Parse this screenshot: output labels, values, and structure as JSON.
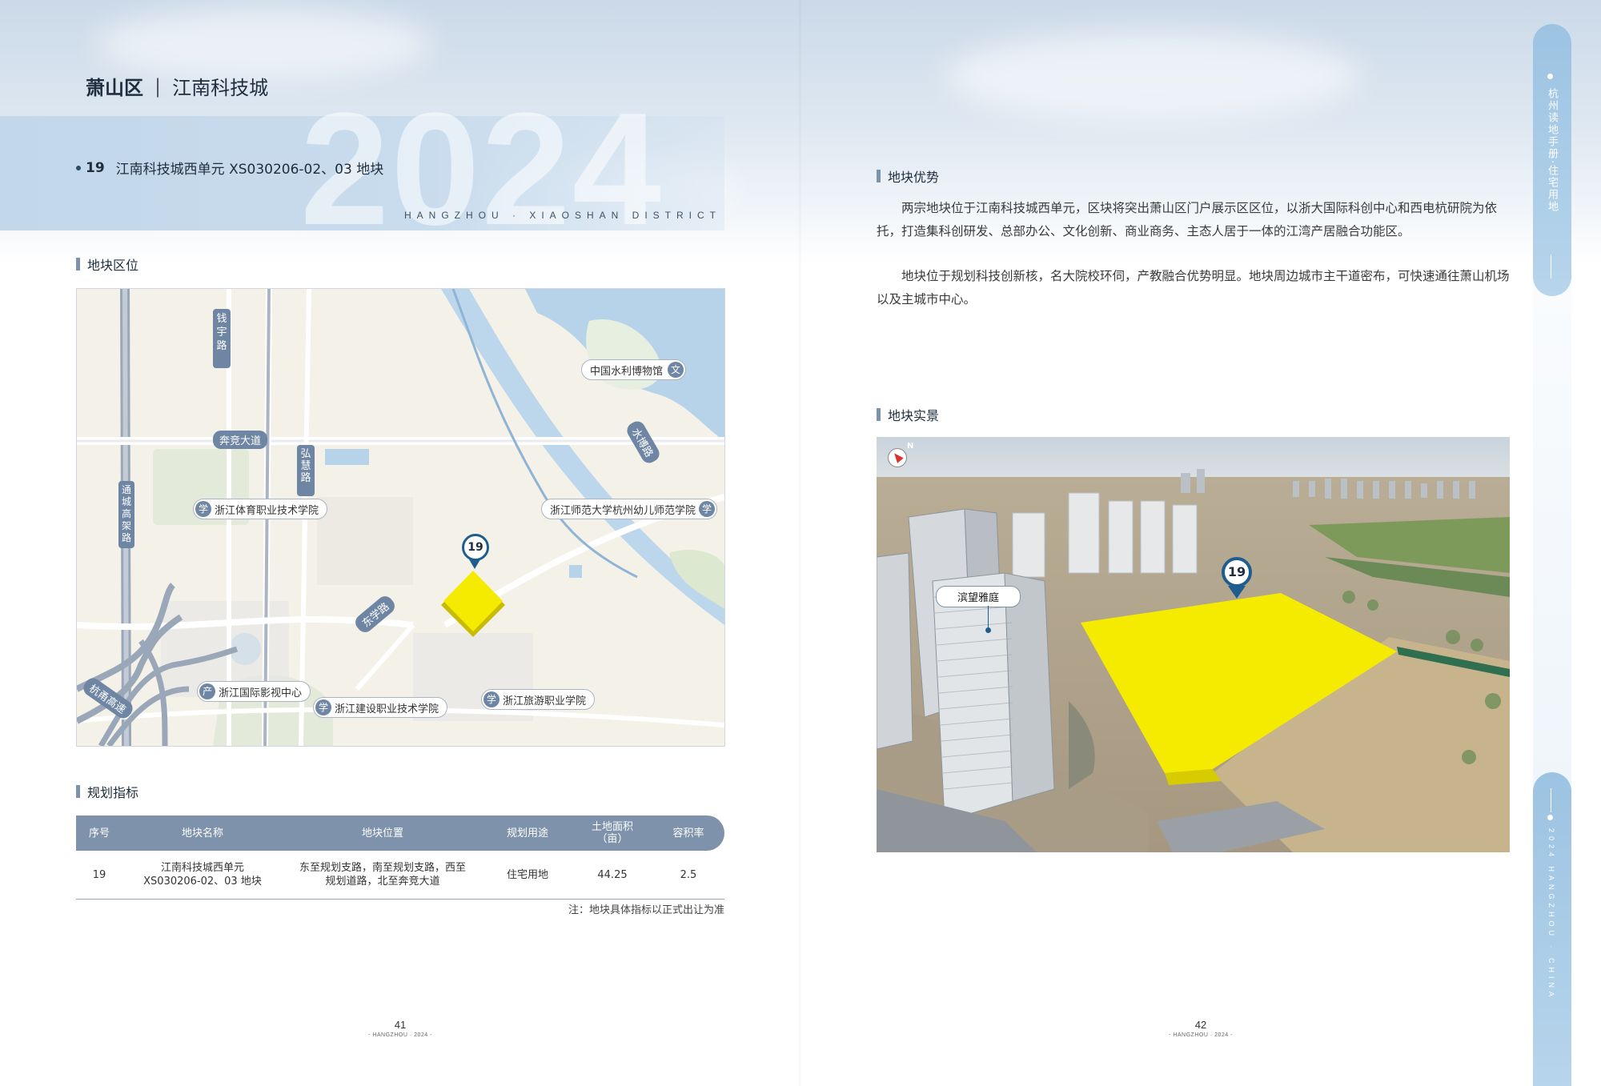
{
  "header": {
    "district_bold": "萧山区",
    "separator": "|",
    "district_light": "江南科技城",
    "year_watermark": "2024",
    "en_subtitle": "HANGZHOU · XIAOSHAN DISTRICT"
  },
  "plot": {
    "number": "19",
    "title": "江南科技城西单元 XS030206-02、03 地块"
  },
  "sections": {
    "location": "地块区位",
    "indicators": "规划指标",
    "advantages": "地块优势",
    "photo": "地块实景"
  },
  "map": {
    "roads": {
      "qianyu": "钱宇路",
      "benjing": "奔竞大道",
      "hongyu": "弘慧路",
      "tongcheng": "通城高架路",
      "dongxue": "东学路",
      "hangnan": "杭甬高速",
      "shuibo": "水博路"
    },
    "pois": {
      "museum": "中国水利博物馆",
      "sport_college": "浙江体育职业技术学院",
      "normal_college": "浙江师范大学杭州幼儿师范学院",
      "film_center": "浙江国际影视中心",
      "construction_college": "浙江建设职业技术学院",
      "tourism_college": "浙江旅游职业学院"
    },
    "poi_icons": {
      "museum": "文",
      "school": "学",
      "industry": "产"
    },
    "marker": "19"
  },
  "table": {
    "headers": [
      "序号",
      "地块名称",
      "地块位置",
      "规划用途",
      "土地面积\n（亩）",
      "容积率"
    ],
    "rows": [
      {
        "index": "19",
        "name_line1": "江南科技城西单元",
        "name_line2": "XS030206-02、03 地块",
        "location_line1": "东至规划支路，南至规划支路，西至",
        "location_line2": "规划道路，北至奔竞大道",
        "usage": "住宅用地",
        "area": "44.25",
        "far": "2.5"
      }
    ],
    "note": "注：地块具体指标以正式出让为准"
  },
  "advantages": {
    "para1": "两宗地块位于江南科技城西单元，区块将突出萧山区门户展示区区位，以浙大国际科创中心和西电杭研院为依托，打造集科创研发、总部办公、文化创新、商业商务、主态人居于一体的江湾产居融合功能区。",
    "para2": "地块位于规划科技创新核，名大院校环伺，产教融合优势明显。地块周边城市主干道密布，可快速通往萧山机场以及主城市中心。"
  },
  "photo": {
    "compass": "N",
    "marker": "19",
    "building_label": "滨望雅庭"
  },
  "footer": {
    "left_page": "41",
    "right_page": "42",
    "small_text": "- HANGZHOU · 2024 -"
  },
  "side_tab": {
    "top_text": "杭州读地手册·住宅用地",
    "bottom_text": "2024 HANGZHOU · CHINA"
  },
  "colors": {
    "accent": "#7e93ab",
    "highlight_yellow": "#f5eb00",
    "marker_blue": "#1f5d8f",
    "band_blue": "#c2d7ea"
  }
}
